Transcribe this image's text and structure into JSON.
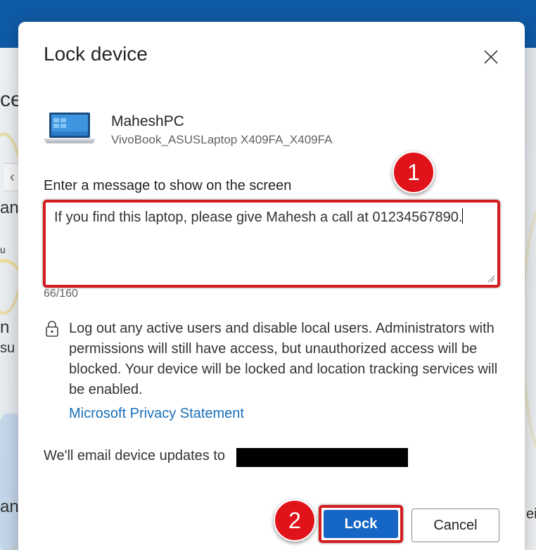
{
  "background": {
    "fragments": [
      "ce",
      "an",
      "u",
      "n",
      "su",
      "an",
      "ei"
    ]
  },
  "dialog": {
    "title": "Lock device",
    "device": {
      "name": "MaheshPC",
      "model": "VivoBook_ASUSLaptop X409FA_X409FA"
    },
    "message": {
      "label": "Enter a message to show on the screen",
      "value": "If you find this laptop, please give Mahesh a call at 01234567890.",
      "counter": "66/160"
    },
    "info": "Log out any active users and disable local users. Administrators with permissions will still have access, but unauthorized access will be blocked. Your device will be locked and location tracking services will be enabled.",
    "privacy_link": "Microsoft Privacy Statement",
    "email_label": "We'll email device updates to",
    "buttons": {
      "lock": "Lock",
      "cancel": "Cancel"
    }
  },
  "annotations": {
    "step1": "1",
    "step2": "2"
  },
  "colors": {
    "header_blue": "#0f5aa6",
    "primary_button": "#1666c5",
    "link": "#1a6fb8",
    "annotation_red": "#e0131b"
  },
  "icons": [
    "close-icon",
    "laptop-icon",
    "lock-icon",
    "resize-grip-icon",
    "chevron-left-icon"
  ]
}
